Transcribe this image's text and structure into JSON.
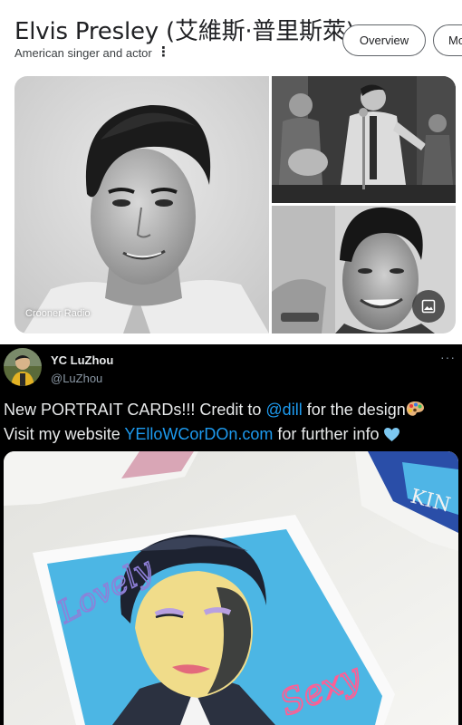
{
  "knowledge_panel": {
    "title": "Elvis Presley (艾維斯·普里斯萊)",
    "subtitle": "American singer and actor",
    "menu_icon": "vertical-dots-icon",
    "chips": [
      "Overview",
      "Mo"
    ],
    "main_image_caption": "Crooner Radio",
    "image_button_icon": "image-icon"
  },
  "tweet": {
    "display_name": "YC LuZhou",
    "handle": "@LuZhou",
    "more_icon": "horizontal-dots-icon",
    "line1_before": "New PORTRAIT CARDs!!! Credit to ",
    "line1_mention": "@dill",
    "line1_after": " for the design",
    "line1_emoji": "artist-palette-icon",
    "line2_before": "Visit my website ",
    "line2_link": "YElloWCorDOn.com",
    "line2_after": " for further info ",
    "line2_emoji": "light-blue-heart-icon",
    "card_text_left": "Lovely",
    "card_text_right": "Sexy",
    "side_card_text": "KIN"
  },
  "colors": {
    "link": "#1d9bf0",
    "card_background": "#4cb6e4",
    "card_face": "#f0dc8a",
    "signature_left": "#8e7fd8",
    "signature_right": "#ff5e93"
  }
}
